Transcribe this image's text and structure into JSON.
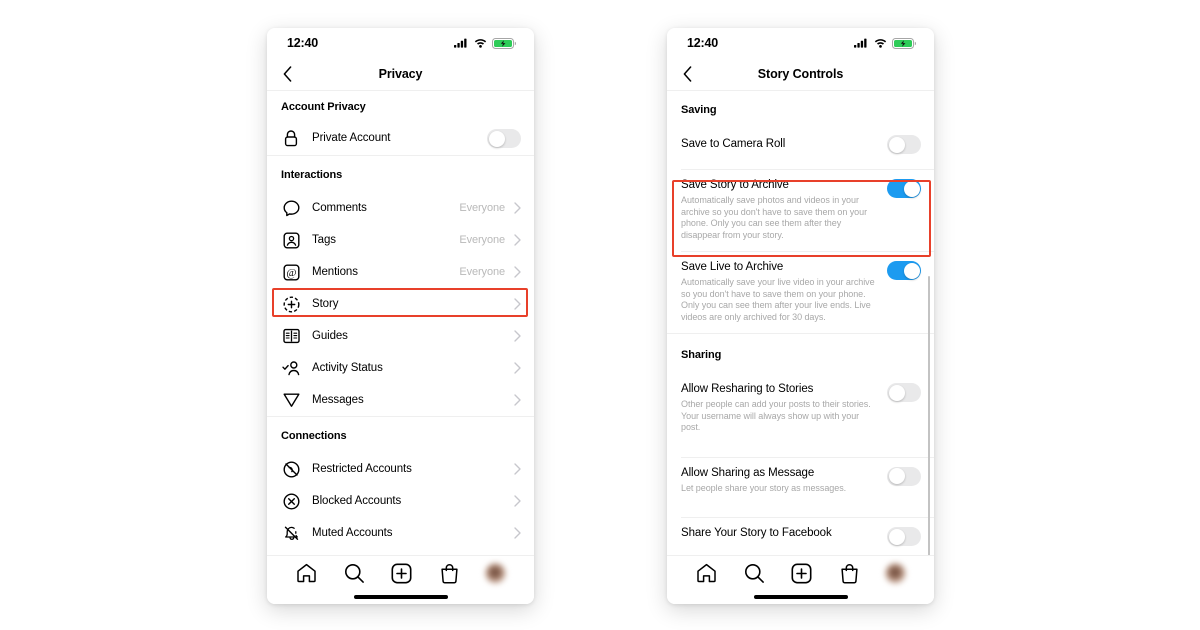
{
  "canvas": {
    "background": "#ffffff",
    "highlight_color": "#e8402a",
    "toggle_on_color": "#1c9bf0",
    "toggle_off_color": "#e9e9ea"
  },
  "left_phone": {
    "status_bar": {
      "time": "12:40",
      "icons": [
        "cellular-signal-icon",
        "wifi-icon",
        "battery-charging-icon"
      ]
    },
    "nav": {
      "back_icon": "chevron-left-icon",
      "title": "Privacy"
    },
    "sections": [
      {
        "header": "Account Privacy",
        "rows": [
          {
            "icon": "lock-icon",
            "label": "Private Account",
            "type": "toggle",
            "on": false
          }
        ]
      },
      {
        "header": "Interactions",
        "rows": [
          {
            "icon": "comment-icon",
            "label": "Comments",
            "value": "Everyone",
            "type": "link",
            "highlighted": false
          },
          {
            "icon": "tag-icon",
            "label": "Tags",
            "value": "Everyone",
            "type": "link",
            "highlighted": false
          },
          {
            "icon": "mention-icon",
            "label": "Mentions",
            "value": "Everyone",
            "type": "link",
            "highlighted": false
          },
          {
            "icon": "story-icon",
            "label": "Story",
            "value": "",
            "type": "link",
            "highlighted": true
          },
          {
            "icon": "guides-icon",
            "label": "Guides",
            "value": "",
            "type": "link",
            "highlighted": false
          },
          {
            "icon": "activity-status-icon",
            "label": "Activity Status",
            "value": "",
            "type": "link",
            "highlighted": false
          },
          {
            "icon": "messages-icon",
            "label": "Messages",
            "value": "",
            "type": "link",
            "highlighted": false
          }
        ]
      },
      {
        "header": "Connections",
        "rows": [
          {
            "icon": "restricted-icon",
            "label": "Restricted Accounts",
            "value": "",
            "type": "link",
            "highlighted": false
          },
          {
            "icon": "blocked-icon",
            "label": "Blocked Accounts",
            "value": "",
            "type": "link",
            "highlighted": false
          },
          {
            "icon": "muted-icon",
            "label": "Muted Accounts",
            "value": "",
            "type": "link",
            "highlighted": false
          }
        ]
      }
    ],
    "tabbar": {
      "items": [
        "home-icon",
        "search-icon",
        "create-post-icon",
        "shop-icon",
        "profile-avatar"
      ]
    }
  },
  "right_phone": {
    "status_bar": {
      "time": "12:40",
      "icons": [
        "cellular-signal-icon",
        "wifi-icon",
        "battery-charging-icon"
      ]
    },
    "nav": {
      "back_icon": "chevron-left-icon",
      "title": "Story Controls"
    },
    "sections": [
      {
        "header": "Saving",
        "rows": [
          {
            "title": "Save to Camera Roll",
            "description": "",
            "on": false,
            "highlighted": false
          },
          {
            "title": "Save Story to Archive",
            "description": "Automatically save photos and videos in your archive so you don't have to save them on your phone. Only you can see them after they disappear from your story.",
            "on": true,
            "highlighted": true
          },
          {
            "title": "Save Live to Archive",
            "description": "Automatically save your live video in your archive so you don't have to save them on your phone. Only you can see them after your live ends. Live videos are only archived for 30 days.",
            "on": true,
            "highlighted": false
          }
        ]
      },
      {
        "header": "Sharing",
        "rows": [
          {
            "title": "Allow Resharing to Stories",
            "description": "Other people can add your posts to their stories. Your username will always show up with your post.",
            "on": false,
            "highlighted": false
          },
          {
            "title": "Allow Sharing as Message",
            "description": "Let people share your story as messages.",
            "on": false,
            "highlighted": false
          },
          {
            "title": "Share Your Story to Facebook",
            "description": "",
            "on": false,
            "highlighted": false
          }
        ]
      }
    ],
    "tabbar": {
      "items": [
        "home-icon",
        "search-icon",
        "create-post-icon",
        "shop-icon",
        "profile-avatar"
      ]
    }
  }
}
